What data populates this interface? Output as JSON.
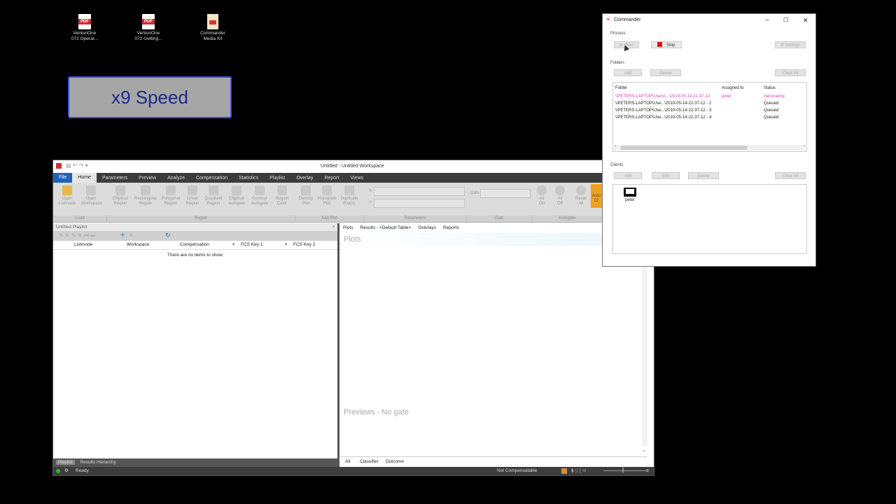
{
  "desktop": {
    "icons": [
      {
        "badge": "PDF",
        "line1": "VenturiOne",
        "line2": "072 Operat..."
      },
      {
        "badge": "PDF",
        "line1": "VenturiOne",
        "line2": "072 Getting..."
      },
      {
        "badge": "",
        "line1": "Commander",
        "line2": "Media Kit"
      }
    ]
  },
  "speed_banner": "x9 Speed",
  "app": {
    "title": "Untitled - Untitled Workspace",
    "ribbon_tabs": [
      "File",
      "Home",
      "Parameters",
      "Preview",
      "Analyze",
      "Compensation",
      "Statistics",
      "Playlist",
      "Overlay",
      "Report",
      "Views"
    ],
    "load_buttons": [
      {
        "l1": "Open",
        "l2": "Listmode"
      },
      {
        "l1": "Open",
        "l2": "Workspace"
      }
    ],
    "region_buttons": [
      {
        "l1": "Elliptical",
        "l2": "Region"
      },
      {
        "l1": "Rectangular",
        "l2": "Region"
      },
      {
        "l1": "Polygonal",
        "l2": "Region"
      },
      {
        "l1": "Linear",
        "l2": "Region"
      },
      {
        "l1": "Quadrant",
        "l2": "Region"
      },
      {
        "l1": "Elliptical",
        "l2": "Autogate"
      },
      {
        "l1": "Contour",
        "l2": "Autogate"
      },
      {
        "l1": "Region",
        "l2": "Color"
      }
    ],
    "plot_buttons": [
      {
        "l1": "Density",
        "l2": "Plot"
      },
      {
        "l1": "Histogram",
        "l2": "Plot"
      },
      {
        "l1": "Duplicate",
        "l2": "Plot(s)"
      }
    ],
    "autogate_buttons": [
      {
        "l1": "All",
        "l2": "On"
      },
      {
        "l1": "All",
        "l2": "Off"
      },
      {
        "l1": "Reset",
        "l2": "All"
      },
      {
        "l1": "Auto",
        "l2": "Cr"
      }
    ],
    "groups": {
      "load": "Load",
      "region": "Region",
      "add_plot": "Add Plot",
      "parameters": "Parameters",
      "gate": "Gate",
      "autogate": "Autogate"
    },
    "params": {
      "x_label": "X",
      "y_label": "Y",
      "gate_label": "Gate"
    },
    "playlist": {
      "title": "Untitled Playlist",
      "pin": "ᵖ",
      "columns": [
        "Listmode",
        "Workspace",
        "Compensation",
        "FCS Key 1",
        "FCS Key 2"
      ],
      "empty_text": "There are no items to show.",
      "bottom_tabs": [
        "Playlist",
        "Results Hierarchy"
      ]
    },
    "right_pane": {
      "tabs": [
        "Plots",
        "Results - <Default Table>",
        "Overlays",
        "Reports"
      ],
      "plots_header": "Plots",
      "previews_text": "Previews - No gate",
      "bottom_tabs": [
        "All",
        "Classifier",
        "Outcome"
      ]
    },
    "status": {
      "left": "Ready",
      "right": "Not Compensatable"
    }
  },
  "commander": {
    "title": "Commander",
    "process_label": "Process",
    "start": "Start",
    "stop": "Stop",
    "settings": "Settings",
    "folders_label": "Folders",
    "add": "Add",
    "delete": "Delete",
    "clear_all": "Clear All",
    "folder_columns": [
      "Folder",
      "Assigned to",
      "Status"
    ],
    "folders": [
      {
        "folder": "\\\\PETERS-LAPTOP\\Users\\...\\2019-05-14-22-37-12",
        "assigned": "peter",
        "status": "Generating",
        "active": true
      },
      {
        "folder": "\\\\PETERS-LAPTOP\\Use...\\2019-05-14-22-37-12 - 2",
        "assigned": "",
        "status": "Queued",
        "active": false
      },
      {
        "folder": "\\\\PETERS-LAPTOP\\Use...\\2019-05-14-22-37-12 - 3",
        "assigned": "",
        "status": "Queued",
        "active": false
      },
      {
        "folder": "\\\\PETERS-LAPTOP\\Use...\\2019-05-14-22-37-12 - 4",
        "assigned": "",
        "status": "Queued",
        "active": false
      }
    ],
    "clients_label": "Clients",
    "edit": "Edit",
    "client_name": "peter"
  },
  "colors": {
    "accent": "#1e63b8",
    "generating": "#e040c0",
    "stop": "#e01010",
    "banner_border": "#3d4fd6"
  }
}
